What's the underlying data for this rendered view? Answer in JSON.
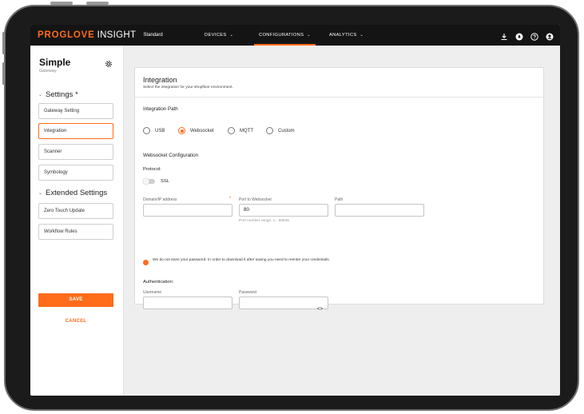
{
  "app": {
    "brand": "PROGLOVE",
    "brand_suffix": "INSIGHT",
    "environment": "Standard"
  },
  "nav": {
    "items": [
      {
        "label": "DEVICES",
        "active": false
      },
      {
        "label": "CONFIGURATIONS",
        "active": true
      },
      {
        "label": "ANALYTICS",
        "active": false
      }
    ],
    "icons": [
      "download-icon",
      "notification-icon",
      "help-icon",
      "account-icon"
    ]
  },
  "sidebar": {
    "title": "Simple",
    "subtitle": "Gateway",
    "settings_section": "Settings *",
    "settings_items": [
      "Gateway Setting",
      "Integration",
      "Scanner",
      "Symbology"
    ],
    "extended_section": "Extended Settings",
    "extended_items": [
      "Zero Touch Update",
      "Workflow Rules"
    ],
    "active_item": "Integration",
    "save_label": "SAVE",
    "cancel_label": "CANCEL"
  },
  "integration": {
    "title": "Integration",
    "description": "Select the integration for your shopfloor environment.",
    "path_heading": "Integration Path",
    "paths": [
      "USB",
      "Websocket",
      "MQTT",
      "Custom"
    ],
    "selected_path": "Websocket",
    "config_heading": "Websocket Configuration",
    "protocol_label": "Protocol:",
    "ssl_label": "SSL",
    "ssl_enabled": false,
    "domain_label": "Domain/IP address",
    "domain_required_mark": "*",
    "domain_value": "",
    "port_label": "Port to Websocket",
    "port_value": "80",
    "port_hint": "Port number range: 1 - 65535",
    "path_label": "Path",
    "path_value": "",
    "notice": "We do not store your password. In order to download it after saving you need to reenter your credentials.",
    "auth_heading": "Authentication:",
    "username_label": "Username",
    "username_value": "",
    "password_label": "Password",
    "password_value": ""
  },
  "colors": {
    "accent": "#ff6c1a",
    "nav_bg": "#141414",
    "page_bg": "#eeeeee"
  }
}
